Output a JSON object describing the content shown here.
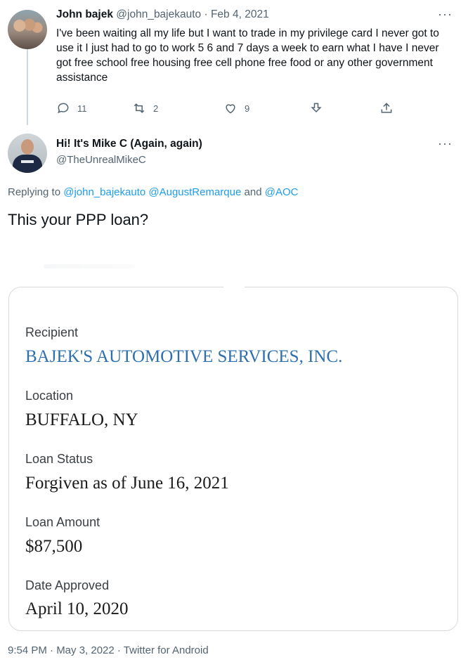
{
  "original_tweet": {
    "author_name": "John bajek",
    "author_handle": "@john_bajekauto",
    "separator": " · ",
    "date": "Feb 4, 2021",
    "more_label": "···",
    "body": "I've been waiting all my life but I want to trade in my privilege card I never got to use it I just had to go to work 5 6 and 7 days a week to earn what I have I never got free school free housing free cell phone free food or any other government assistance",
    "actions": {
      "replies": "11",
      "retweets": "2",
      "likes": "9"
    }
  },
  "reply_tweet": {
    "author_name": "Hi! It's Mike C (Again, again)",
    "author_handle": "@TheUnrealMikeC",
    "more_label": "···",
    "replying_prefix": "Replying to ",
    "replying_to": [
      "@john_bajekauto",
      "@AugustRemarque"
    ],
    "replying_and": " and ",
    "replying_last": "@AOC",
    "text": "This your PPP loan?",
    "loan_card": {
      "recipient_label": "Recipient",
      "recipient_value": "BAJEK'S AUTOMOTIVE SERVICES, INC.",
      "location_label": "Location",
      "location_value": "BUFFALO, NY",
      "status_label": "Loan Status",
      "status_value": "Forgiven as of June 16, 2021",
      "amount_label": "Loan Amount",
      "amount_value": "$87,500",
      "approved_label": "Date Approved",
      "approved_value": "April 10, 2020"
    },
    "footer": "9:54 PM · May 3, 2022 · Twitter for Android"
  },
  "icons": [
    "reply-icon",
    "retweet-icon",
    "like-icon",
    "share-icon",
    "upload-icon",
    "more-icon"
  ],
  "colors": {
    "link_blue": "#1d9bf0",
    "secondary_text": "#536471",
    "card_value_blue": "#2e6fb0"
  }
}
